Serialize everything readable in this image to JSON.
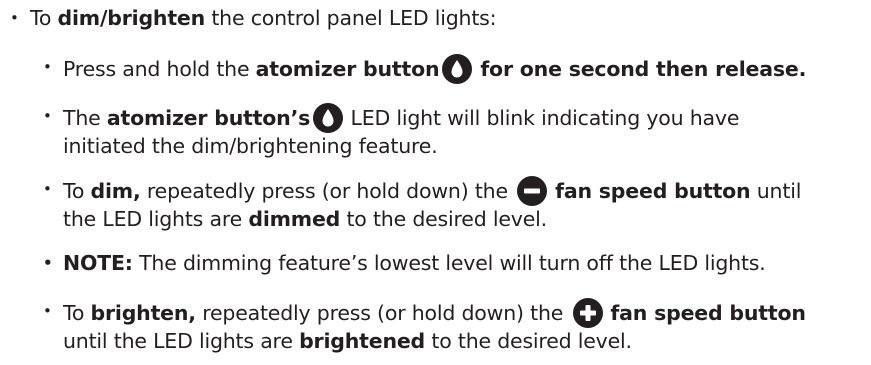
{
  "bullet_glyph": "•",
  "intro": {
    "pre": "To ",
    "bold": "dim/brighten",
    "post": " the control panel LED lights:"
  },
  "steps": [
    {
      "pre": "Press and hold the ",
      "bold1": "atomizer button",
      "icon": "droplet-icon",
      "bold2": " for one second then release."
    },
    {
      "pre": "The ",
      "bold1": "atomizer button’s",
      "icon": "droplet-icon",
      "post1": " LED light will blink indicating you have",
      "line2": "initiated the dim/brightening feature."
    },
    {
      "pre": "To ",
      "bold1": "dim,",
      "mid": " repeatedly press (or hold down) the ",
      "icon": "minus-icon",
      "bold2": " fan speed button",
      "post1": " until",
      "line2_pre": "the LED lights are ",
      "line2_bold": "dimmed",
      "line2_post": " to the desired level."
    },
    {
      "bold1": "NOTE:",
      "post1": " The dimming feature’s lowest level will turn off the LED lights."
    },
    {
      "pre": "To ",
      "bold1": "brighten,",
      "mid": " repeatedly press (or hold down) the ",
      "icon": "plus-icon",
      "bold2": " fan speed button",
      "line2_pre": "until the LED lights are ",
      "line2_bold": "brightened",
      "line2_post": " to the desired level."
    }
  ],
  "icon_color": "#231f20"
}
